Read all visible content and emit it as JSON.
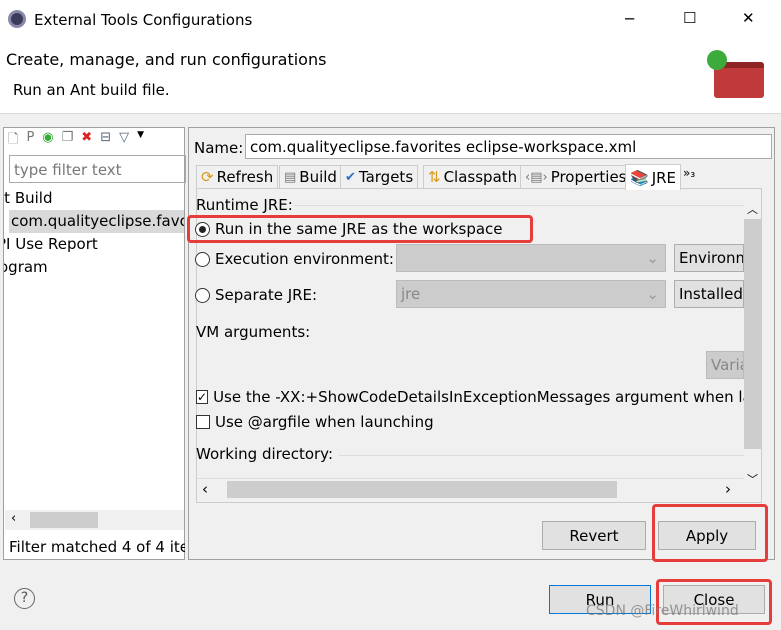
{
  "window": {
    "title": "External Tools Configurations",
    "minimize": "─",
    "maximize": "☐",
    "close": "✕"
  },
  "header": {
    "title": "Create, manage, and run configurations",
    "subtitle": "Run an Ant build file."
  },
  "left": {
    "filter_placeholder": "type filter text",
    "items": [
      {
        "label": "it Build"
      },
      {
        "label": "com.qualityeclipse.favo"
      },
      {
        "label": "PI Use Report"
      },
      {
        "label": "ogram"
      }
    ],
    "status": "Filter matched 4 of 4 ite"
  },
  "right": {
    "name_label": "Name:",
    "name_value": "com.qualityeclipse.favorites eclipse-workspace.xml",
    "tabs": [
      {
        "label": "Refresh"
      },
      {
        "label": "Build"
      },
      {
        "label": "Targets"
      },
      {
        "label": "Classpath"
      },
      {
        "label": "Properties"
      },
      {
        "label": "JRE"
      },
      {
        "label": "»₃"
      }
    ],
    "active_tab": "JRE",
    "runtime_jre_label": "Runtime JRE:",
    "radio_same": "Run in the same JRE as the workspace",
    "radio_exec": "Execution environment:",
    "radio_separate": "Separate JRE:",
    "separate_value": "jre",
    "environments_button": "Environm",
    "installed_button": "Installed",
    "vm_args_label": "VM arguments:",
    "variables_button": "Varia",
    "check_show_details": "Use the -XX:+ShowCodeDetailsInExceptionMessages argument when lau",
    "check_show_details_checked": true,
    "check_argfile": "Use @argfile when launching",
    "check_argfile_checked": false,
    "working_dir_label": "Working directory:",
    "revert": "Revert",
    "apply": "Apply"
  },
  "footer": {
    "help": "?",
    "run": "Run",
    "close": "Close"
  },
  "watermark": "CSDN @FireWhirlwind",
  "colors": {
    "highlight": "#e53c3c",
    "selection": "#d9d9d9",
    "default_button_border": "#0078d7"
  }
}
